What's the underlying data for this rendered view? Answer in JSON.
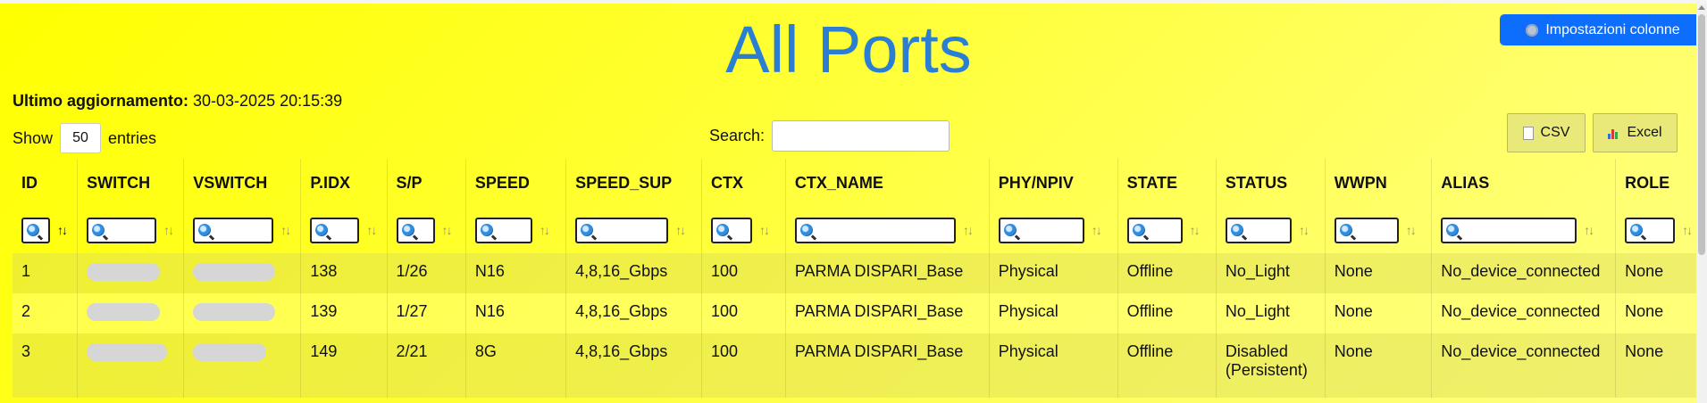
{
  "header": {
    "title": "All Ports",
    "settings_label": "Impostazioni colonne"
  },
  "status": {
    "updated_label": "Ultimo aggiornamento:",
    "updated_value": "30-03-2025 20:15:39"
  },
  "length": {
    "show_label": "Show",
    "value": "50",
    "entries_label": "entries"
  },
  "search": {
    "label": "Search:",
    "value": ""
  },
  "export": {
    "csv_label": "CSV",
    "excel_label": "Excel"
  },
  "table": {
    "columns": [
      "ID",
      "SWITCH",
      "VSWITCH",
      "P.IDX",
      "S/P",
      "SPEED",
      "SPEED_SUP",
      "CTX",
      "CTX_NAME",
      "PHY/NPIV",
      "STATE",
      "STATUS",
      "WWPN",
      "ALIAS",
      "ROLE"
    ],
    "rows": [
      {
        "id": "1",
        "switch": "",
        "vswitch": "",
        "pidx": "138",
        "sp": "1/26",
        "speed": "N16",
        "speed_sup": "4,8,16_Gbps",
        "ctx": "100",
        "ctx_name": "PARMA DISPARI_Base",
        "phy": "Physical",
        "state": "Offline",
        "status": "No_Light",
        "wwpn": "None",
        "alias": "No_device_connected",
        "role": "None"
      },
      {
        "id": "2",
        "switch": "",
        "vswitch": "",
        "pidx": "139",
        "sp": "1/27",
        "speed": "N16",
        "speed_sup": "4,8,16_Gbps",
        "ctx": "100",
        "ctx_name": "PARMA DISPARI_Base",
        "phy": "Physical",
        "state": "Offline",
        "status": "No_Light",
        "wwpn": "None",
        "alias": "No_device_connected",
        "role": "None"
      },
      {
        "id": "3",
        "switch": "",
        "vswitch": "",
        "pidx": "149",
        "sp": "2/21",
        "speed": "8G",
        "speed_sup": "4,8,16_Gbps",
        "ctx": "100",
        "ctx_name": "PARMA DISPARI_Base",
        "phy": "Physical",
        "state": "Offline",
        "status": "Disabled (Persistent)",
        "wwpn": "None",
        "alias": "No_device_connected",
        "role": "None"
      }
    ]
  },
  "colors": {
    "background": "#ffff00",
    "title": "#2a7fd4",
    "primary_button": "#0d6efd",
    "export_button": "#e9e97a"
  },
  "icons": [
    "gear-icon",
    "document-icon",
    "bar-chart-icon",
    "magnifier-icon",
    "sort-icon"
  ]
}
